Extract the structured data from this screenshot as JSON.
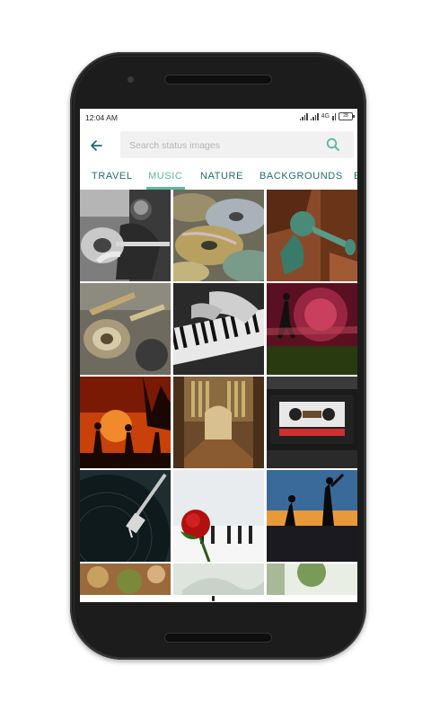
{
  "status_bar": {
    "time": "12:04 AM",
    "network": "4G",
    "battery": "28"
  },
  "search": {
    "placeholder": "Search status images",
    "value": "",
    "back_icon": "arrow-left-icon",
    "search_icon": "magnifier-icon"
  },
  "tabs": [
    {
      "label": "TRAVEL",
      "active": false
    },
    {
      "label": "MUSIC",
      "active": true
    },
    {
      "label": "NATURE",
      "active": false
    },
    {
      "label": "BACKGROUNDS",
      "active": false
    },
    {
      "label": "B",
      "active": false
    }
  ],
  "colors": {
    "accent": "#5bb8a3",
    "tab_text": "#1f6e72",
    "back_arrow": "#1f6e72",
    "search_background": "#f1f1f1"
  },
  "images": [
    {
      "subject": "man-playing-guitar"
    },
    {
      "subject": "compact-discs"
    },
    {
      "subject": "statue-with-horn"
    },
    {
      "subject": "brass-band-tuba"
    },
    {
      "subject": "hands-on-piano-keys"
    },
    {
      "subject": "dancer-with-lights"
    },
    {
      "subject": "silhouettes-dancing-at-sunset"
    },
    {
      "subject": "church-organ-interior"
    },
    {
      "subject": "cassette-tape"
    },
    {
      "subject": "vinyl-turntable-needle"
    },
    {
      "subject": "red-rose-on-piano"
    },
    {
      "subject": "silhouettes-on-beach-sunset"
    },
    {
      "subject": "partial-image-bottom-left"
    },
    {
      "subject": "partial-image-bottom-middle"
    },
    {
      "subject": "partial-image-bottom-right"
    }
  ]
}
